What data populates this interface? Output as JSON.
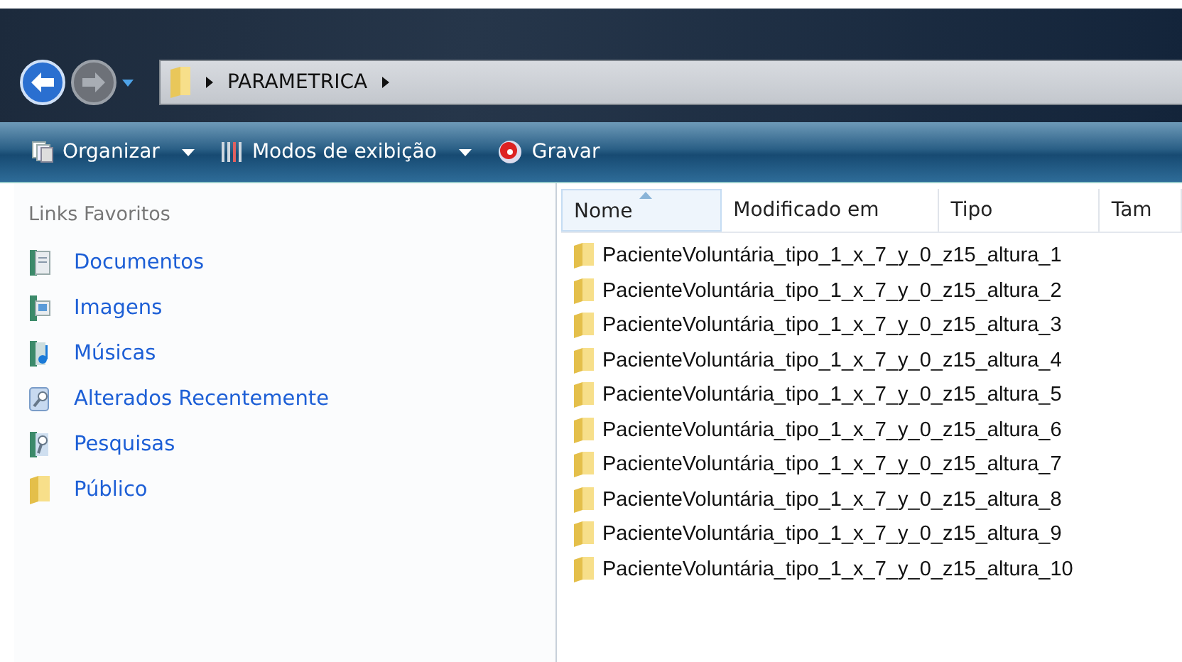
{
  "address_bar": {
    "crumbs": [
      "PARAMETRICA"
    ]
  },
  "toolbar": [
    {
      "label": "Organizar",
      "kind": "organize",
      "has_menu": true
    },
    {
      "label": "Modos de exibição",
      "kind": "views",
      "has_menu": true
    },
    {
      "label": "Gravar",
      "kind": "burn",
      "has_menu": false
    }
  ],
  "sidebar": {
    "title": "Links Favoritos",
    "items": [
      {
        "label": "Documentos",
        "kind": "documents"
      },
      {
        "label": "Imagens",
        "kind": "pictures"
      },
      {
        "label": "Músicas",
        "kind": "music"
      },
      {
        "label": "Alterados Recentemente",
        "kind": "recent"
      },
      {
        "label": "Pesquisas",
        "kind": "searches"
      },
      {
        "label": "Público",
        "kind": "folder"
      }
    ]
  },
  "table": {
    "columns": [
      {
        "label": "Nome",
        "sorted": true
      },
      {
        "label": "Modificado em",
        "sorted": false
      },
      {
        "label": "Tipo",
        "sorted": false
      },
      {
        "label": "Tam",
        "sorted": false
      }
    ],
    "rows": [
      {
        "name": "PacienteVoluntária_tipo_1_x_7_y_0_z15_altura_1"
      },
      {
        "name": "PacienteVoluntária_tipo_1_x_7_y_0_z15_altura_2"
      },
      {
        "name": "PacienteVoluntária_tipo_1_x_7_y_0_z15_altura_3"
      },
      {
        "name": "PacienteVoluntária_tipo_1_x_7_y_0_z15_altura_4"
      },
      {
        "name": "PacienteVoluntária_tipo_1_x_7_y_0_z15_altura_5"
      },
      {
        "name": "PacienteVoluntária_tipo_1_x_7_y_0_z15_altura_6"
      },
      {
        "name": "PacienteVoluntária_tipo_1_x_7_y_0_z15_altura_7"
      },
      {
        "name": "PacienteVoluntária_tipo_1_x_7_y_0_z15_altura_8"
      },
      {
        "name": "PacienteVoluntária_tipo_1_x_7_y_0_z15_altura_9"
      },
      {
        "name": "PacienteVoluntária_tipo_1_x_7_y_0_z15_altura_10"
      }
    ]
  }
}
